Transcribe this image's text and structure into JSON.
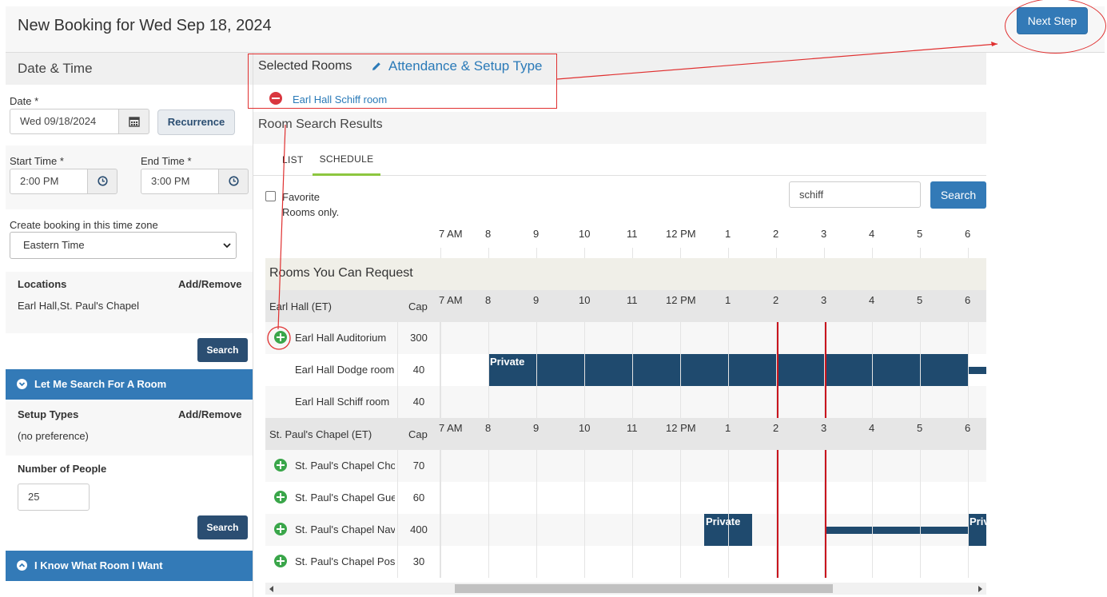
{
  "header": {
    "title": "New Booking for Wed Sep 18, 2024",
    "next_step_label": "Next Step"
  },
  "left": {
    "date_time_heading": "Date & Time",
    "date_label": "Date *",
    "date_value": "Wed 09/18/2024",
    "recurrence_label": "Recurrence",
    "start_time_label": "Start Time *",
    "start_time_value": "2:00 PM",
    "end_time_label": "End Time *",
    "end_time_value": "3:00 PM",
    "timezone_label": "Create booking in this time zone",
    "timezone_value": "Eastern Time",
    "locations_label": "Locations",
    "locations_add_remove": "Add/Remove",
    "locations_value": "Earl Hall,St. Paul's Chapel",
    "search_label": "Search",
    "let_me_search_label": "Let Me Search For A Room",
    "setup_types_label": "Setup Types",
    "setup_add_remove": "Add/Remove",
    "setup_value": "(no preference)",
    "people_label": "Number of People",
    "people_value": "25",
    "search2_label": "Search",
    "i_know_label": "I Know What Room I Want"
  },
  "selected": {
    "title": "Selected Rooms",
    "attendance_link": "Attendance & Setup Type",
    "room": "Earl Hall Schiff room"
  },
  "results": {
    "title": "Room Search Results",
    "tab_list": "LIST",
    "tab_schedule": "SCHEDULE",
    "favorite_line1": "Favorite",
    "favorite_line2": "Rooms only.",
    "search_value": "schiff",
    "search_button": "Search"
  },
  "schedule": {
    "hours": [
      "7 AM",
      "8",
      "9",
      "10",
      "11",
      "12 PM",
      "1",
      "2",
      "3",
      "4",
      "5",
      "6"
    ],
    "section_title": "Rooms You Can Request",
    "cap_label": "Cap",
    "buildings": [
      {
        "name": "Earl Hall (ET)",
        "rooms": [
          {
            "name": "Earl Hall Auditorium",
            "cap": "300",
            "addable": true
          },
          {
            "name": "Earl Hall Dodge room",
            "cap": "40",
            "addable": false
          },
          {
            "name": "Earl Hall Schiff room",
            "cap": "40",
            "addable": false
          }
        ]
      },
      {
        "name": "St. Paul's Chapel (ET)",
        "rooms": [
          {
            "name": "St. Paul's Chapel Choir",
            "cap": "70",
            "addable": true
          },
          {
            "name": "St. Paul's Chapel Guest",
            "cap": "60",
            "addable": true
          },
          {
            "name": "St. Paul's Chapel Nave",
            "cap": "400",
            "addable": true
          },
          {
            "name": "St. Paul's Chapel Post",
            "cap": "30",
            "addable": true
          }
        ]
      }
    ],
    "event_label": "Private",
    "selected_start": "2 PM",
    "selected_end": "3 PM"
  },
  "colors": {
    "accent": "#337ab7",
    "dark": "#2b4e72",
    "event": "#1f4a6e",
    "add": "#3aa64a",
    "remove": "#d9363e",
    "marker": "#c9151e"
  }
}
